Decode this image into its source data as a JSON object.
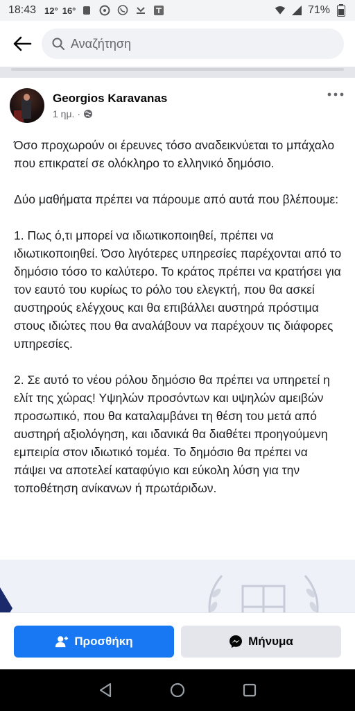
{
  "status_bar": {
    "time": "18:43",
    "temp_primary": "12°",
    "temp_secondary": "16°",
    "battery": "71%"
  },
  "search": {
    "placeholder": "Αναζήτηση"
  },
  "post": {
    "author": "Georgios Karavanas",
    "timestamp": "1 ημ.",
    "separator": "·",
    "paragraphs": [
      "Όσο προχωρούν οι έρευνες τόσο αναδεικνύεται το μπάχαλο που επικρατεί σε ολόκληρο το ελληνικό δημόσιο.",
      "Δύο μαθήματα πρέπει να πάρουμε από αυτά που βλέπουμε:",
      "1. Πως ό,τι μπορεί να ιδιωτικοποιηθεί, πρέπει να ιδιωτικοποιηθεί. Όσο λιγότερες υπηρεσίες παρέχονται από το δημόσιο τόσο το καλύτερο. Το κράτος πρέπει να κρατήσει για τον εαυτό του κυρίως το ρόλο του ελεγκτή, που θα ασκεί αυστηρούς ελέγχους και θα επιβάλλει αυστηρά πρόστιμα στους ιδιώτες που θα αναλάβουν να παρέχουν τις διάφορες υπηρεσίες.",
      "2. Σε αυτό το νέου ρόλου δημόσιο θα πρέπει να υπηρετεί η ελίτ της χώρας! Υψηλών προσόντων και υψηλών αμειβών προσωπικό, που θα καταλαμβάνει τη θέση του μετά από αυστηρή αξιολόγηση, και ιδανικά θα διαθέτει προηγούμενη εμπειρία στον ιδιωτικό τομέα. Το δημόσιο θα πρέπει να πάψει να αποτελεί καταφύγιο και εύκολη λύση για την τοποθέτηση ανίκανων ή πρωτάριδων."
    ]
  },
  "actions": {
    "add_friend": "Προσθήκη",
    "message": "Μήνυμα"
  },
  "colors": {
    "primary": "#1877f2",
    "secondary_bg": "#e4e6eb"
  }
}
